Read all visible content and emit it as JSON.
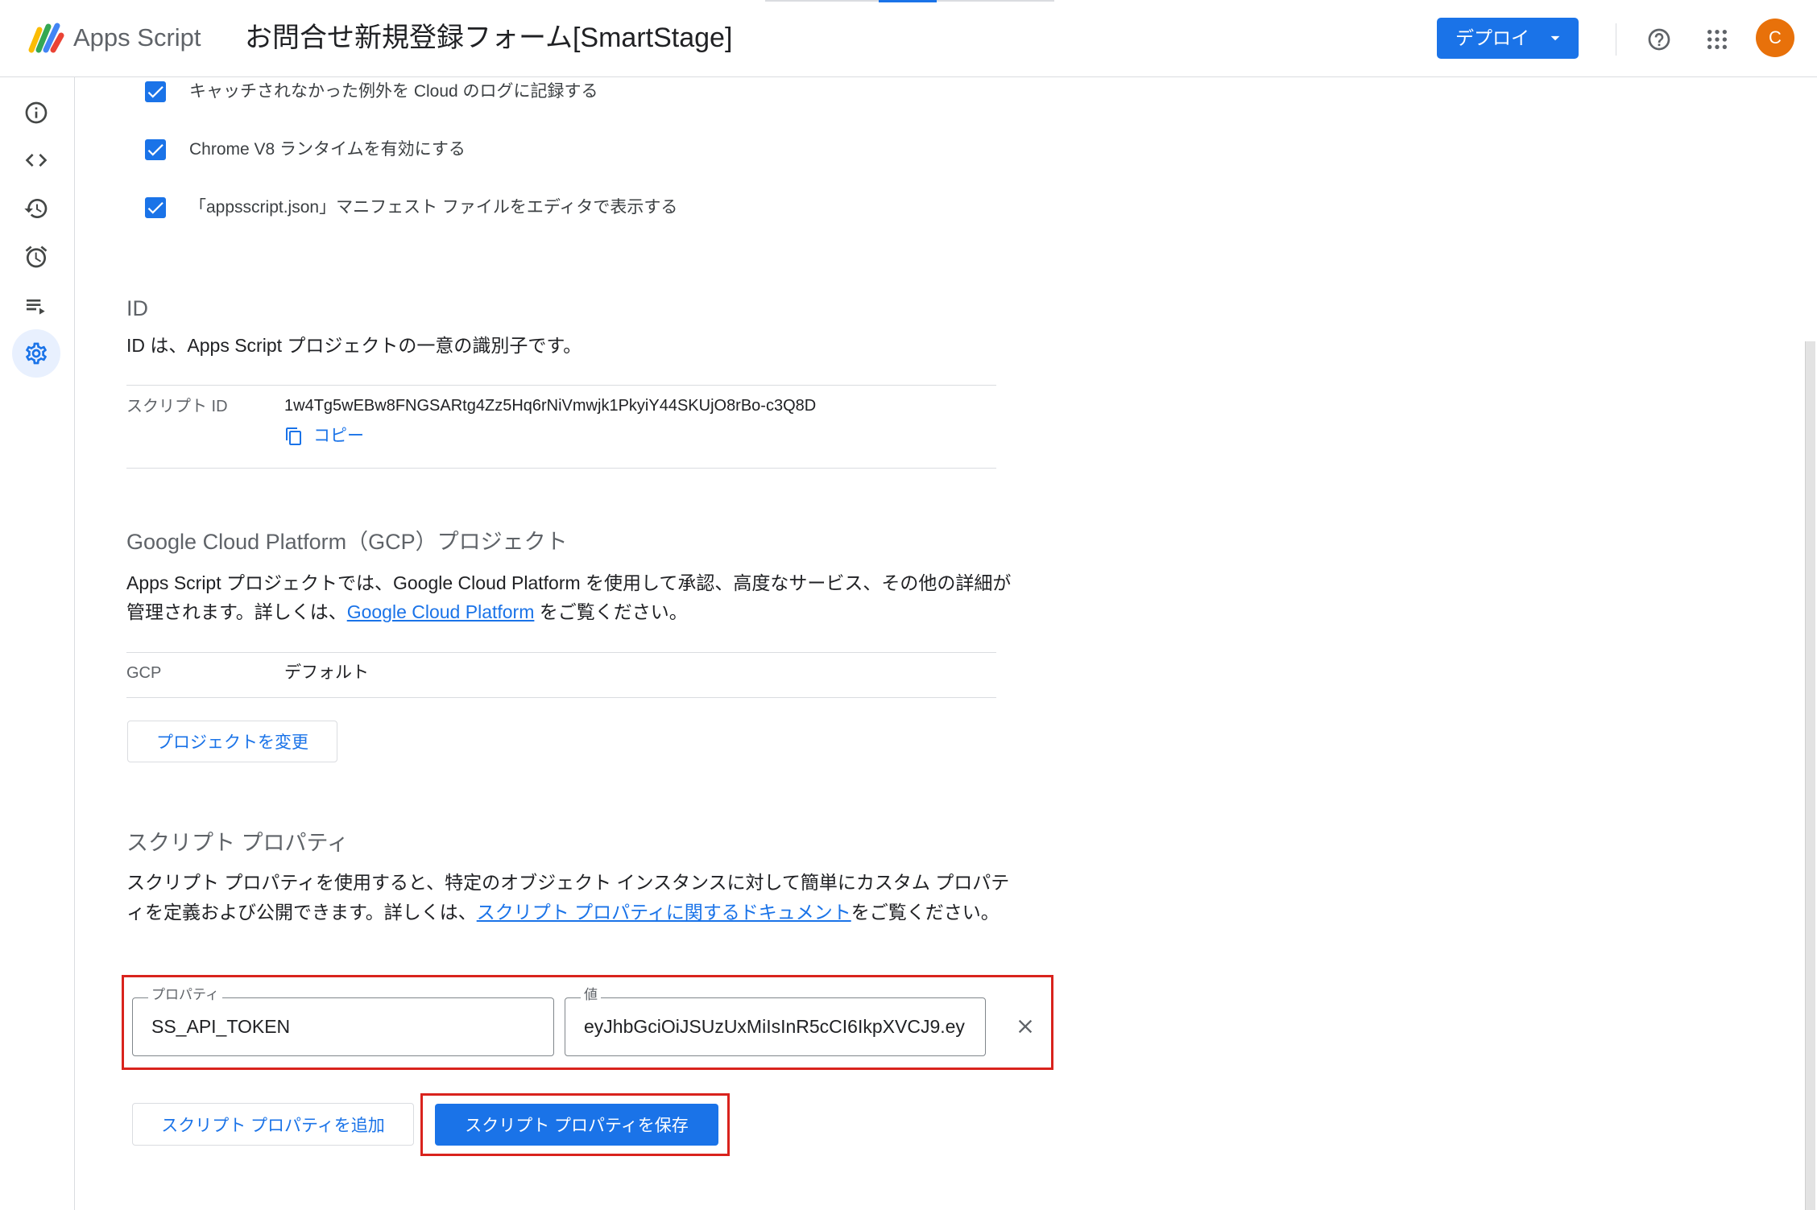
{
  "colors": {
    "accent": "#1a73e8",
    "highlight": "#d9231d",
    "avatar": "#e8710a"
  },
  "header": {
    "product_name": "Apps Script",
    "project_title": "お問合せ新規登録フォーム[SmartStage]",
    "deploy_label": "デプロイ",
    "avatar_initial": "C",
    "icons": [
      "apps-script-logo",
      "help-icon",
      "apps-grid-icon"
    ]
  },
  "sidebar": {
    "items": [
      {
        "icon": "info-icon",
        "active": false
      },
      {
        "icon": "code-icon",
        "active": false
      },
      {
        "icon": "history-icon",
        "active": false
      },
      {
        "icon": "alarm-icon",
        "active": false
      },
      {
        "icon": "executions-icon",
        "active": false
      },
      {
        "icon": "gear-icon",
        "active": true
      }
    ]
  },
  "settings": {
    "checkboxes": [
      {
        "label": "キャッチされなかった例外を Cloud のログに記録する",
        "checked": true
      },
      {
        "label": "Chrome V8 ランタイムを有効にする",
        "checked": true
      },
      {
        "label": "「appsscript.json」マニフェスト ファイルをエディタで表示する",
        "checked": true
      }
    ],
    "id_section": {
      "heading": "ID",
      "description": "ID は、Apps Script プロジェクトの一意の識別子です。",
      "script_id_label": "スクリプト ID",
      "script_id_value": "1w4Tg5wEBw8FNGSARtg4Zz5Hq6rNiVmwjk1PkyiY44SKUjO8rBo-c3Q8D",
      "copy_label": "コピー"
    },
    "gcp_section": {
      "heading": "Google Cloud Platform（GCP）プロジェクト",
      "description_pre": "Apps Script プロジェクトでは、Google Cloud Platform を使用して承認、高度なサービス、その他の詳細が管理されます。詳しくは、",
      "description_link": "Google Cloud Platform",
      "description_post": " をご覧ください。",
      "gcp_label": "GCP",
      "gcp_value": "デフォルト",
      "change_button": "プロジェクトを変更"
    },
    "script_properties": {
      "heading": "スクリプト プロパティ",
      "description_pre": "スクリプト プロパティを使用すると、特定のオブジェクト インスタンスに対して簡単にカスタム プロパティを定義および公開できます。詳しくは、",
      "description_link": "スクリプト プロパティに関するドキュメント",
      "description_post": "をご覧ください。",
      "rows": [
        {
          "property_label": "プロパティ",
          "property_value": "SS_API_TOKEN",
          "value_label": "値",
          "value": "eyJhbGciOiJSUzUxMiIsInR5cCI6IkpXVCJ9.ey"
        }
      ],
      "add_button": "スクリプト プロパティを追加",
      "save_button": "スクリプト プロパティを保存"
    }
  }
}
